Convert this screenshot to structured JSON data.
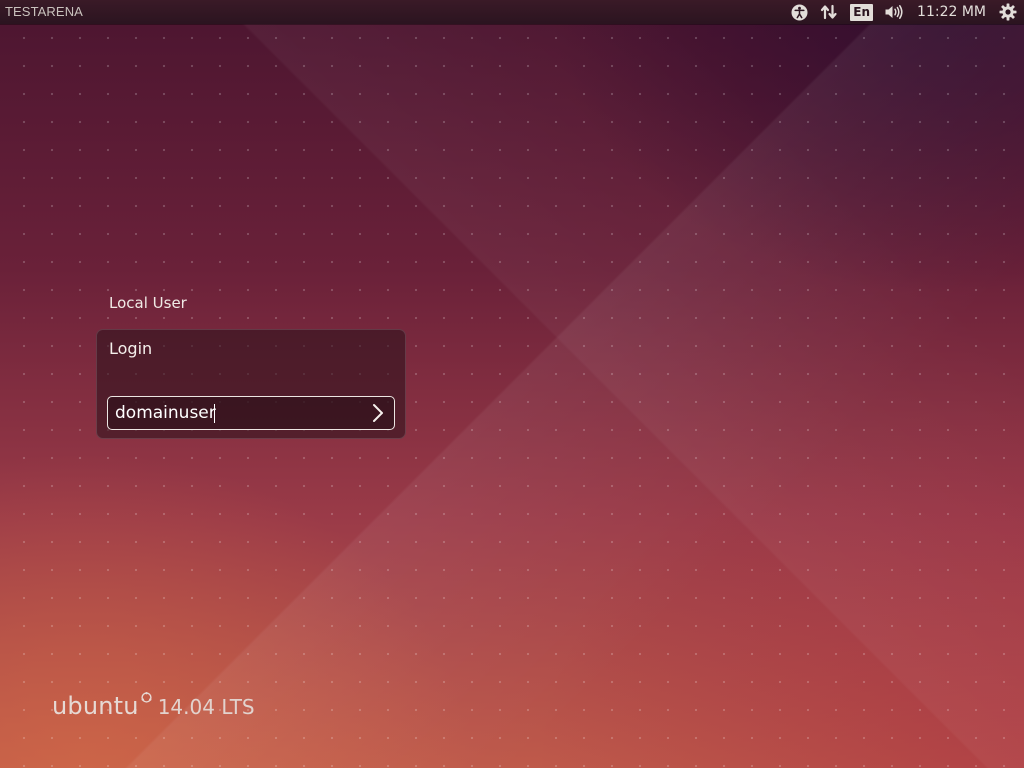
{
  "top_panel": {
    "hostname": "TESTARENA",
    "keyboard_layout": "En",
    "clock": "11:22 MM",
    "icons": [
      "accessibility-icon",
      "network-icon",
      "keyboard-layout-indicator",
      "volume-icon",
      "session-gear-icon"
    ]
  },
  "greeter": {
    "user_label": "Local User",
    "card_title": "Login",
    "username_value": "domainuser"
  },
  "branding": {
    "wordmark": "ubuntu",
    "version": "14.04 LTS"
  },
  "colors": {
    "panel": "#2b1420",
    "background_top": "#4b1530",
    "background_bottom": "#bf5a4a",
    "text": "#f0eae6"
  }
}
